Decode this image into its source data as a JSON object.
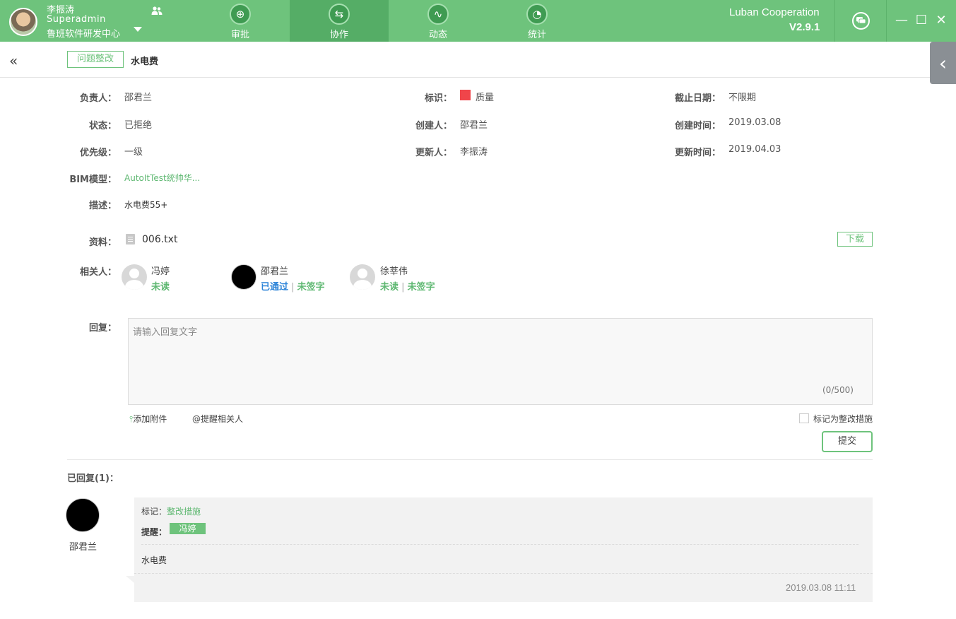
{
  "user": {
    "name": "李振涛",
    "role": "Superadmin",
    "org": "鲁班软件研发中心"
  },
  "nav": [
    {
      "label": "审批",
      "icon": "approval-icon"
    },
    {
      "label": "协作",
      "icon": "collaboration-icon"
    },
    {
      "label": "动态",
      "icon": "activity-icon"
    },
    {
      "label": "统计",
      "icon": "statistics-icon"
    }
  ],
  "brand": {
    "name": "Luban Cooperation",
    "version": "V2.9.1"
  },
  "window": {
    "minimize": "—",
    "maximize": "☐",
    "close": "✕"
  },
  "breadcrumb": {
    "tag": "问题整改",
    "title": "水电费"
  },
  "details": {
    "owner_label": "负责人：",
    "owner": "邵君兰",
    "mark_label": "标识：",
    "mark": "质量",
    "mark_color": "#f0454a",
    "deadline_label": "截止日期：",
    "deadline": "不限期",
    "status_label": "状态：",
    "status": "已拒绝",
    "creator_label": "创建人：",
    "creator": "邵君兰",
    "created_label": "创建时间：",
    "created": "2019.03.08",
    "priority_label": "优先级：",
    "priority": "一级",
    "updater_label": "更新人：",
    "updater": "李振涛",
    "updated_label": "更新时间：",
    "updated": "2019.04.03",
    "bim_label": "BIM模型：",
    "bim": "AutoItTest统帅华...",
    "desc_label": "描述：",
    "desc": "水电费55+",
    "attach_label": "资料：",
    "attach_file": "006.txt",
    "download": "下载",
    "related_label": "相关人："
  },
  "related": [
    {
      "name": "冯婷",
      "status1": "未读",
      "status2": ""
    },
    {
      "name": "邵君兰",
      "status1": "已通过",
      "status2": "未签字"
    },
    {
      "name": "徐莘伟",
      "status1": "未读",
      "status2": "未签字"
    }
  ],
  "reply_form": {
    "label": "回复：",
    "placeholder": "请输入回复文字",
    "counter": "(0/500)",
    "attach": "添加附件",
    "remind": "@提醒相关人",
    "mark_measure": "标记为整改措施",
    "submit": "提交"
  },
  "replies_title": "已回复(1)：",
  "reply": {
    "author": "邵君兰",
    "mark_label": "标记：",
    "mark_value": "整改措施",
    "remind_label": "提醒：",
    "remind_person": "冯婷",
    "body": "水电费",
    "time": "2019.03.08 11:11"
  },
  "colors": {
    "header": "#6ec37c",
    "header_active": "#55ad66",
    "accent": "#5fb872",
    "link_blue": "#2d84d8"
  }
}
